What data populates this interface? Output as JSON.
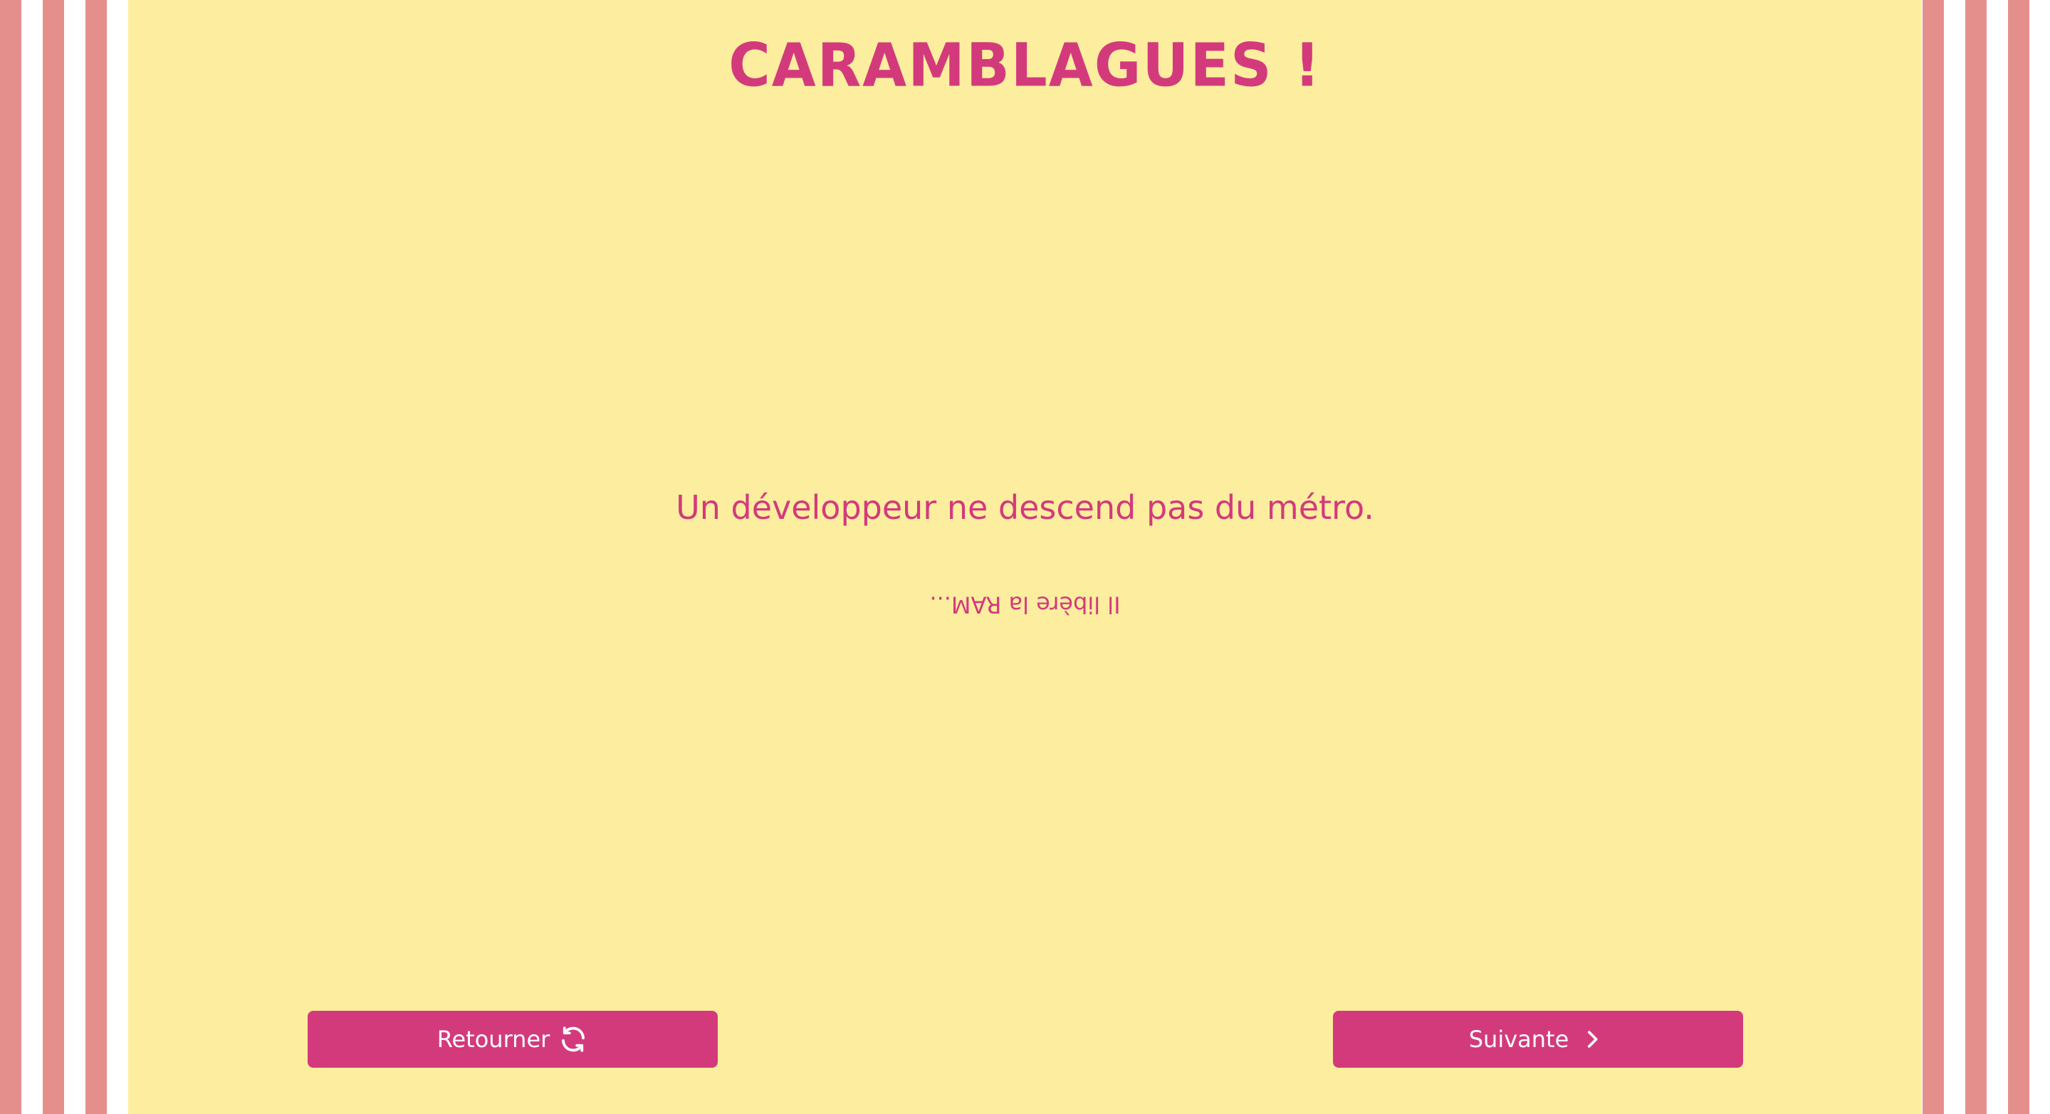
{
  "title": "CARAMBLAGUES !",
  "joke": {
    "question": "Un développeur ne descend pas du métro.",
    "answer": "Il libère la RAM..."
  },
  "buttons": {
    "flip_label": "Retourner",
    "next_label": "Suivante"
  },
  "icons": {
    "flip": "refresh-icon",
    "next": "chevron-right-icon"
  },
  "colors": {
    "accent": "#d33a7c",
    "card_background": "#fcee9e",
    "stripe": "#e58f8d",
    "stripe_alt": "#ffffff"
  }
}
